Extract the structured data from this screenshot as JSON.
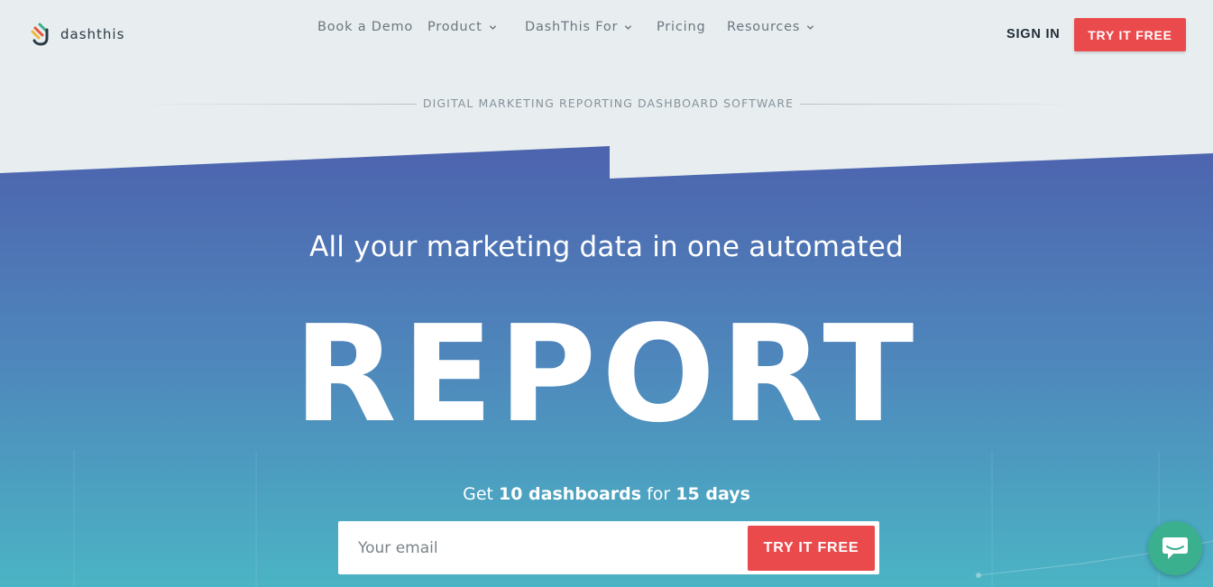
{
  "brand": {
    "name": "dashthis"
  },
  "nav": {
    "items": [
      {
        "label": "Book a Demo",
        "has_dropdown": false
      },
      {
        "label": "Product",
        "has_dropdown": true
      },
      {
        "label": "DashThis For",
        "has_dropdown": true
      },
      {
        "label": "Pricing",
        "has_dropdown": false
      },
      {
        "label": "Resources",
        "has_dropdown": true
      }
    ],
    "sign_in": "SIGN IN",
    "try_free": "TRY IT FREE"
  },
  "tagline": "DIGITAL MARKETING REPORTING DASHBOARD SOFTWARE",
  "hero": {
    "subtitle": "All your marketing data in one automated",
    "title": "REPORT",
    "offer": {
      "prefix": "Get ",
      "count": "10 dashboards",
      "middle": " for ",
      "duration": "15 days"
    },
    "email_placeholder": "Your email",
    "cta": "TRY IT FREE"
  },
  "colors": {
    "accent": "#eb4a4d",
    "gradient_top": "#4d66b0",
    "gradient_bottom": "#4bb3c4",
    "chat": "#3bb08f"
  },
  "icons": {
    "chat": "chat-bubble-icon",
    "chevron": "chevron-down-icon"
  }
}
